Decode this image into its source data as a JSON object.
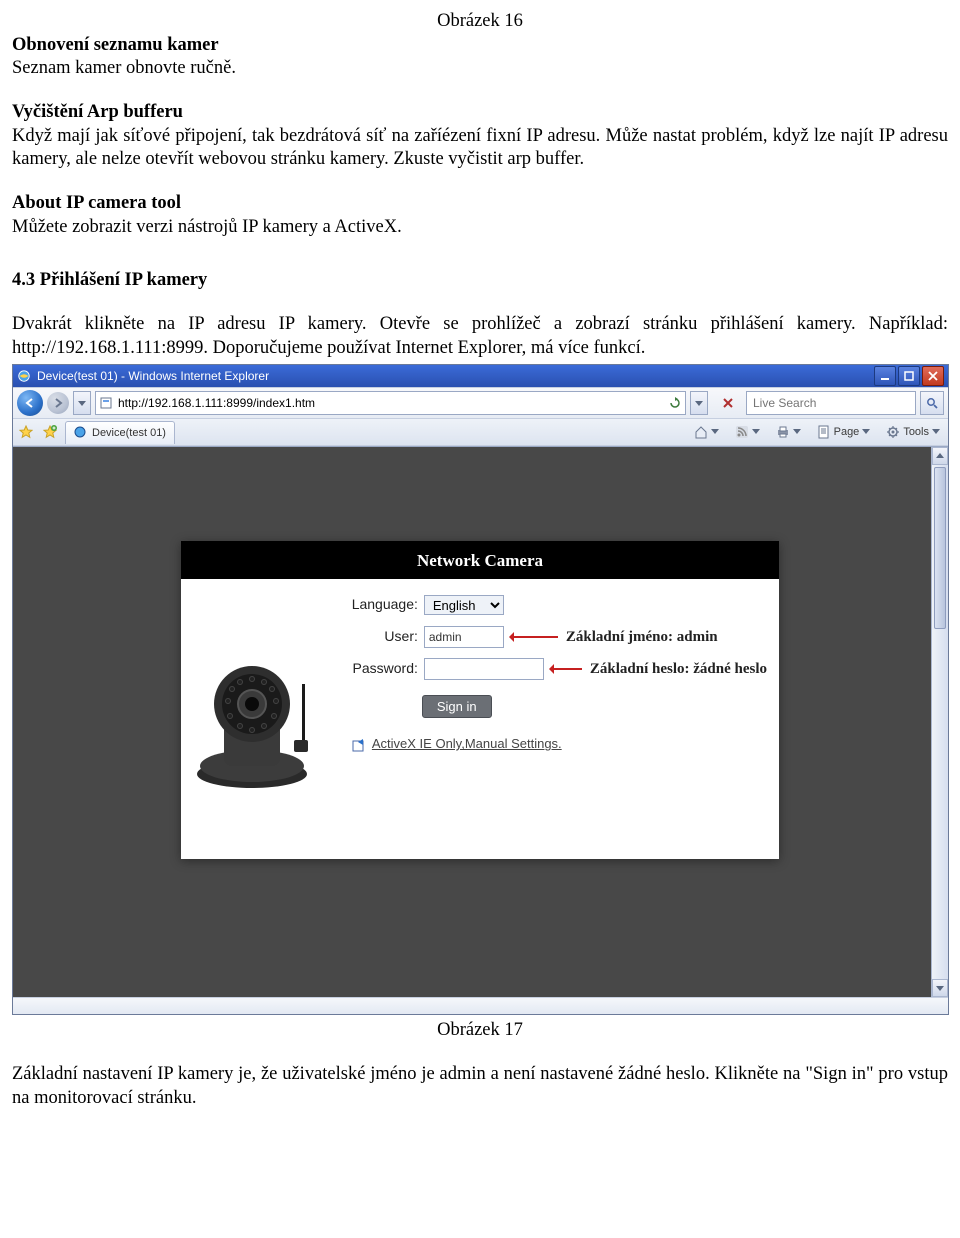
{
  "fig1": "Obrázek 16",
  "h1": "Obnovení seznamu kamer",
  "p1": "Seznam kamer obnovte ručně.",
  "h2": "Vyčištění Arp bufferu",
  "p2": "Když mají jak síťové připojení, tak bezdrátová síť na zaříézení fixní IP adresu. Může nastat problém, když lze najít IP adresu kamery, ale nelze otevřít webovou stránku kamery. Zkuste vyčistit arp buffer.",
  "h3": "About IP camera tool",
  "p3": "Můžete zobrazit verzi nástrojů IP kamery a ActiveX.",
  "h4": "4.3 Přihlášení IP kamery",
  "p4": "Dvakrát klikněte na IP adresu IP kamery. Otevře se prohlížeč a zobrazí stránku přihlášení kamery. Například: http://192.168.1.111:8999. Doporučujeme používat Internet Explorer, má více funkcí.",
  "browser": {
    "title": "Device(test 01) - Windows Internet Explorer",
    "url": "http://192.168.1.111:8999/index1.htm",
    "tab": "Device(test 01)",
    "search_placeholder": "Live Search",
    "page_label": "Page",
    "tools_label": "Tools"
  },
  "login": {
    "header": "Network Camera",
    "language_label": "Language:",
    "language_value": "English",
    "user_label": "User:",
    "user_value": "admin",
    "password_label": "Password:",
    "signin": "Sign in",
    "activex": "ActiveX IE Only,Manual Settings.",
    "anno_user": "Základní jméno: admin",
    "anno_pwd": "Základní heslo: žádné heslo"
  },
  "fig2": "Obrázek 17",
  "p5": "Základní nastavení IP kamery je, že uživatelské jméno je admin a není nastavené žádné heslo. Klikněte na \"Sign in\" pro vstup na monitorovací stránku."
}
